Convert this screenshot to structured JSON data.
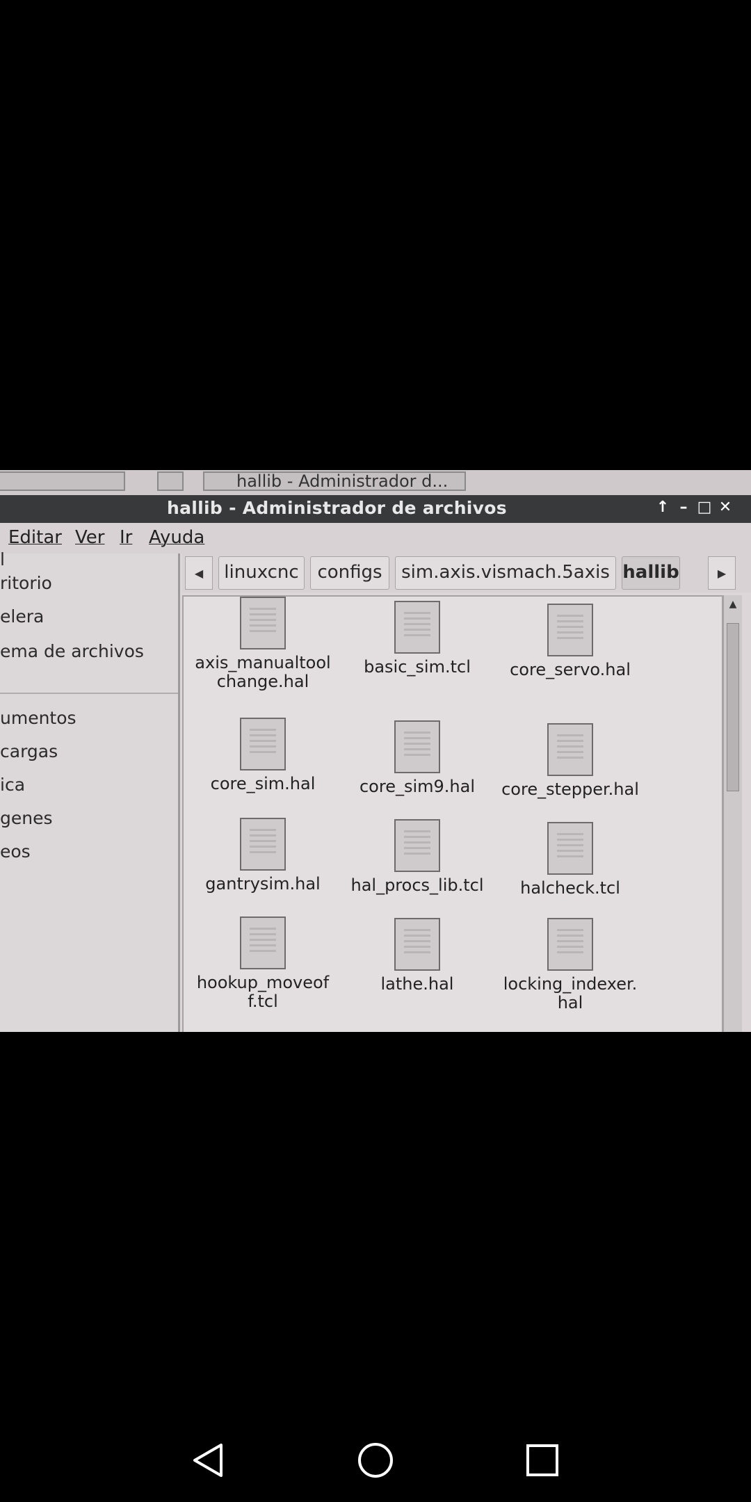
{
  "taskbar": {
    "window_label": "hallib - Administrador d..."
  },
  "window": {
    "title": "hallib - Administrador de archivos",
    "controls": [
      "up-icon",
      "minimize-icon",
      "maximize-icon",
      "close-icon"
    ]
  },
  "menu": {
    "items": [
      "Editar",
      "Ver",
      "Ir",
      "Ayuda"
    ]
  },
  "sidebar": {
    "items": [
      "l",
      "ritorio",
      "elera",
      "ema de archivos",
      "umentos",
      "cargas",
      "ica",
      "genes",
      "eos"
    ]
  },
  "pathbar": {
    "crumbs": [
      "linuxcnc",
      "configs",
      "sim.axis.vismach.5axis",
      "hallib"
    ],
    "active": "hallib"
  },
  "files": [
    {
      "line1": "axis_manualtool",
      "line2": "change.hal"
    },
    {
      "line1": "basic_sim.tcl",
      "line2": ""
    },
    {
      "line1": "core_servo.hal",
      "line2": ""
    },
    {
      "line1": "core_sim.hal",
      "line2": ""
    },
    {
      "line1": "core_sim9.hal",
      "line2": ""
    },
    {
      "line1": "core_stepper.hal",
      "line2": ""
    },
    {
      "line1": "gantrysim.hal",
      "line2": ""
    },
    {
      "line1": "hal_procs_lib.tcl",
      "line2": ""
    },
    {
      "line1": "halcheck.tcl",
      "line2": ""
    },
    {
      "line1": "hookup_moveof",
      "line2": "f.tcl"
    },
    {
      "line1": "lathe.hal",
      "line2": ""
    },
    {
      "line1": "locking_indexer.",
      "line2": "hal"
    }
  ],
  "colors": {
    "titlebar": "#38393b",
    "window_bg": "#ddd6d8",
    "content_bg": "#e3dfe0"
  }
}
